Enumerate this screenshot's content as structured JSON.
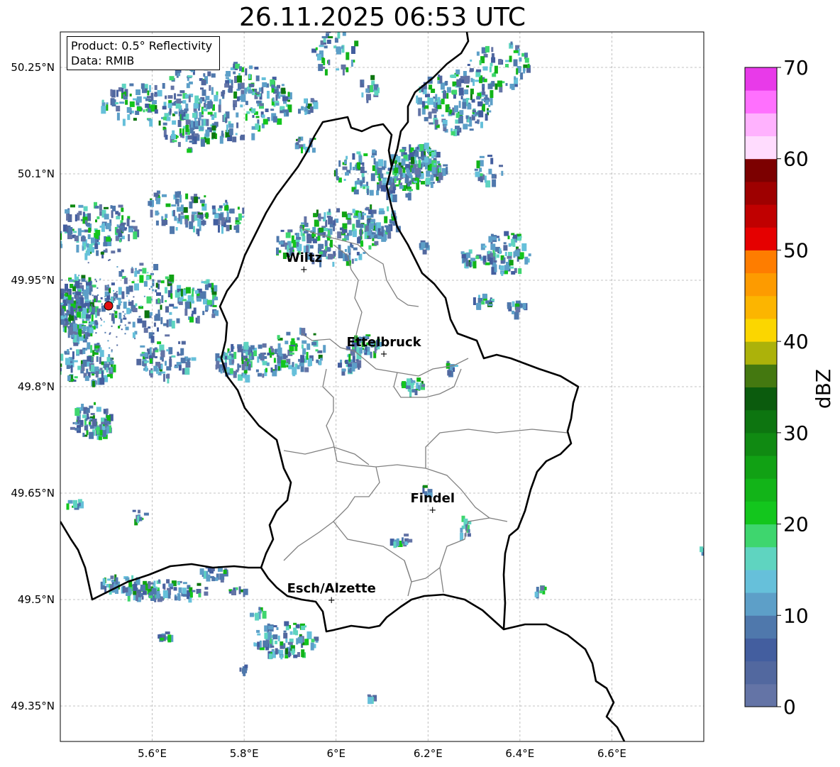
{
  "title": "26.11.2025 06:53 UTC",
  "info": {
    "product": "Product: 0.5° Reflectivity",
    "data": "Data: RMIB"
  },
  "map": {
    "lon_range": [
      5.4,
      6.8
    ],
    "lat_range": [
      49.3,
      50.3
    ],
    "lat_ticks": [
      {
        "value": 50.25,
        "label": "50.25°N"
      },
      {
        "value": 50.1,
        "label": "50.1°N"
      },
      {
        "value": 49.95,
        "label": "49.95°N"
      },
      {
        "value": 49.8,
        "label": "49.8°N"
      },
      {
        "value": 49.65,
        "label": "49.65°N"
      },
      {
        "value": 49.5,
        "label": "49.5°N"
      },
      {
        "value": 49.35,
        "label": "49.35°N"
      }
    ],
    "lon_ticks": [
      {
        "value": 5.6,
        "label": "5.6°E"
      },
      {
        "value": 5.8,
        "label": "5.8°E"
      },
      {
        "value": 6.0,
        "label": "6°E"
      },
      {
        "value": 6.2,
        "label": "6.2°E"
      },
      {
        "value": 6.4,
        "label": "6.4°E"
      },
      {
        "value": 6.6,
        "label": "6.6°E"
      }
    ],
    "grid": true,
    "cities": [
      {
        "name": "Wiltz",
        "lon": 5.93,
        "lat": 49.966
      },
      {
        "name": "Ettelbruck",
        "lon": 6.104,
        "lat": 49.847
      },
      {
        "name": "Findel",
        "lon": 6.21,
        "lat": 49.627
      },
      {
        "name": "Esch/Alzette",
        "lon": 5.99,
        "lat": 49.5
      }
    ],
    "radar_site": {
      "name": "radar-site",
      "lon": 5.505,
      "lat": 49.914,
      "color": "#e01010"
    }
  },
  "colorbar": {
    "label": "dBZ",
    "min": 0,
    "max": 70,
    "step": 2.5,
    "ticks": [
      "0",
      "10",
      "20",
      "30",
      "40",
      "50",
      "60",
      "70"
    ],
    "colors": [
      "#6474a6",
      "#52689f",
      "#435e9f",
      "#4f78ac",
      "#5d9fc8",
      "#66c0da",
      "#5fd4c0",
      "#3ed66e",
      "#13c61d",
      "#12b418",
      "#11a114",
      "#108a12",
      "#0d7510",
      "#0b5b0d",
      "#447810",
      "#acb20a",
      "#fbd600",
      "#fcb500",
      "#fd9b00",
      "#fe7d00",
      "#e50000",
      "#c00000",
      "#9e0000",
      "#7c0000",
      "#ffdcfe",
      "#ffb2fe",
      "#ff70fe",
      "#e83ae9"
    ]
  },
  "chart_data": {
    "type": "heatmap",
    "title": "26.11.2025 06:53 UTC",
    "xlabel": "",
    "ylabel": "",
    "xlim": [
      5.4,
      6.8
    ],
    "ylim": [
      49.3,
      50.3
    ],
    "colorbar_label": "dBZ",
    "colorbar_range": [
      0,
      70
    ]
  }
}
